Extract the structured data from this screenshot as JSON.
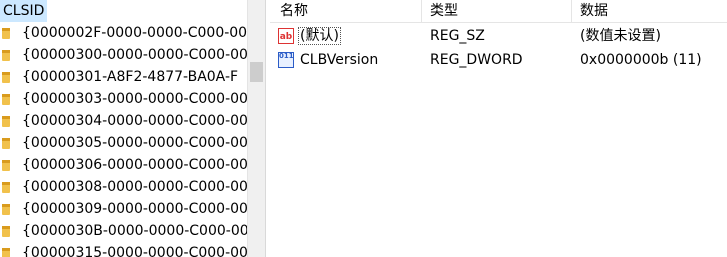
{
  "tree": {
    "root_label": "CLSID",
    "items": [
      "{0000002F-0000-0000-C000-00",
      "{00000300-0000-0000-C000-00",
      "{00000301-A8F2-4877-BA0A-F",
      "{00000303-0000-0000-C000-00",
      "{00000304-0000-0000-C000-00",
      "{00000305-0000-0000-C000-00",
      "{00000306-0000-0000-C000-00",
      "{00000308-0000-0000-C000-00",
      "{00000309-0000-0000-C000-00",
      "{0000030B-0000-0000-C000-00",
      "{00000315-0000-0000-C000-00"
    ]
  },
  "list": {
    "columns": {
      "name": "名称",
      "type": "类型",
      "data": "数据"
    },
    "rows": [
      {
        "icon": "string-value-icon",
        "icon_text": "ab",
        "name": "(默认)",
        "type": "REG_SZ",
        "data": "(数值未设置)"
      },
      {
        "icon": "dword-value-icon",
        "icon_text": "011",
        "name": "CLBVersion",
        "type": "REG_DWORD",
        "data": "0x0000000b (11)"
      }
    ]
  },
  "colors": {
    "selection": "#cce8ff",
    "folder": "#f1c14b",
    "scrollbar": "#f0f0f0"
  }
}
